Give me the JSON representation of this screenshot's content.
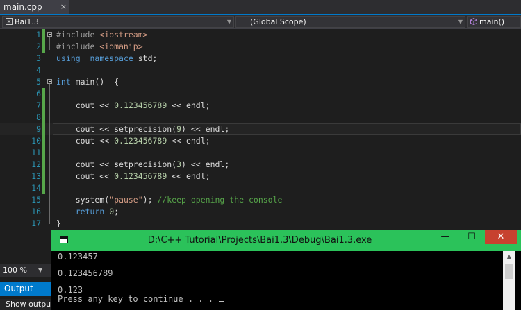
{
  "tab": {
    "title": "main.cpp",
    "close_glyph": "×"
  },
  "navbar": {
    "project": "Bai1.3",
    "scope": "(Global Scope)",
    "function": "main()"
  },
  "editor": {
    "lines": [
      {
        "n": "1",
        "changed": true,
        "fold": true,
        "code": [
          [
            "pp",
            "#include "
          ],
          [
            "inc",
            "<iostream>"
          ]
        ]
      },
      {
        "n": "2",
        "changed": true,
        "code": [
          [
            "pp",
            "#include "
          ],
          [
            "inc",
            "<iomanip>"
          ]
        ]
      },
      {
        "n": "3",
        "code": [
          [
            "kw",
            "using"
          ],
          [
            "",
            "  "
          ],
          [
            "kw",
            "namespace"
          ],
          [
            "",
            " std;"
          ]
        ]
      },
      {
        "n": "4",
        "code": []
      },
      {
        "n": "5",
        "fold": true,
        "code": [
          [
            "kw",
            "int"
          ],
          [
            "",
            " main()  {"
          ]
        ]
      },
      {
        "n": "6",
        "changed": true,
        "code": []
      },
      {
        "n": "7",
        "changed": true,
        "code": [
          [
            "",
            "    cout << "
          ],
          [
            "num",
            "0.123456789"
          ],
          [
            "",
            " << endl;"
          ]
        ]
      },
      {
        "n": "8",
        "changed": true,
        "code": []
      },
      {
        "n": "9",
        "changed": true,
        "current": true,
        "code": [
          [
            "",
            "    cout << setprecision("
          ],
          [
            "num",
            "9"
          ],
          [
            "",
            ") << endl;"
          ]
        ]
      },
      {
        "n": "10",
        "changed": true,
        "code": [
          [
            "",
            "    cout << "
          ],
          [
            "num",
            "0.123456789"
          ],
          [
            "",
            " << endl;"
          ]
        ]
      },
      {
        "n": "11",
        "changed": true,
        "code": []
      },
      {
        "n": "12",
        "changed": true,
        "code": [
          [
            "",
            "    cout << setprecision("
          ],
          [
            "num",
            "3"
          ],
          [
            "",
            ") << endl;"
          ]
        ]
      },
      {
        "n": "13",
        "changed": true,
        "code": [
          [
            "",
            "    cout << "
          ],
          [
            "num",
            "0.123456789"
          ],
          [
            "",
            " << endl;"
          ]
        ]
      },
      {
        "n": "14",
        "changed": true,
        "code": []
      },
      {
        "n": "15",
        "code": [
          [
            "",
            "    system("
          ],
          [
            "str",
            "\"pause\""
          ],
          [
            "",
            "); "
          ],
          [
            "cm",
            "//keep opening the console"
          ]
        ]
      },
      {
        "n": "16",
        "code": [
          [
            "",
            "    "
          ],
          [
            "kw",
            "return"
          ],
          [
            "",
            " "
          ],
          [
            "num",
            "0"
          ],
          [
            "",
            ";"
          ]
        ]
      },
      {
        "n": "17",
        "code": [
          [
            "",
            "}"
          ]
        ]
      }
    ]
  },
  "zoom": {
    "value": "100 %"
  },
  "output_panel": {
    "tab_label": "Output",
    "show_output_label": "Show output from:"
  },
  "console": {
    "title": "D:\\C++ Tutorial\\Projects\\Bai1.3\\Debug\\Bai1.3.exe",
    "lines": [
      "0.123457",
      "0.123456789",
      "0.123",
      "Press any key to continue . . . "
    ],
    "buttons": {
      "minimize": "—",
      "maximize": "☐",
      "close": "✕"
    }
  },
  "colors": {
    "accent": "#007acc",
    "console_titlebar": "#2bc25a",
    "close_button": "#c7412f",
    "changed_bar": "#57a64a"
  }
}
